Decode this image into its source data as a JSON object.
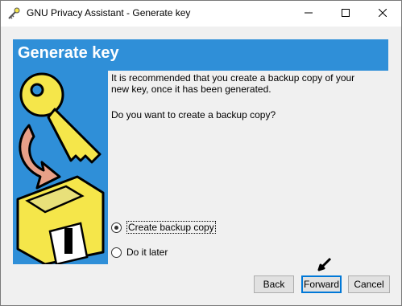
{
  "window": {
    "title": "GNU Privacy Assistant - Generate key",
    "app_icon": "gpa-key-icon"
  },
  "titlebar_buttons": {
    "minimize": "minimize-icon",
    "maximize": "maximize-icon",
    "close": "close-icon"
  },
  "banner": {
    "title": "Generate key"
  },
  "side_panel": {
    "illustration": "key-floppy-backup-illustration"
  },
  "content": {
    "paragraph1_line1": "It is recommended that you create a backup copy of your",
    "paragraph1_line2": "new key, once it has been generated.",
    "paragraph2": "Do you want to create a backup copy?"
  },
  "options": {
    "create_backup": "Create backup copy",
    "do_it_later": "Do it later",
    "selected": "create_backup"
  },
  "buttons": {
    "back": "Back",
    "forward": "Forward",
    "cancel": "Cancel"
  },
  "colors": {
    "accent": "#2f8fd8",
    "focus": "#0078d7",
    "key": "#f5e64a"
  }
}
